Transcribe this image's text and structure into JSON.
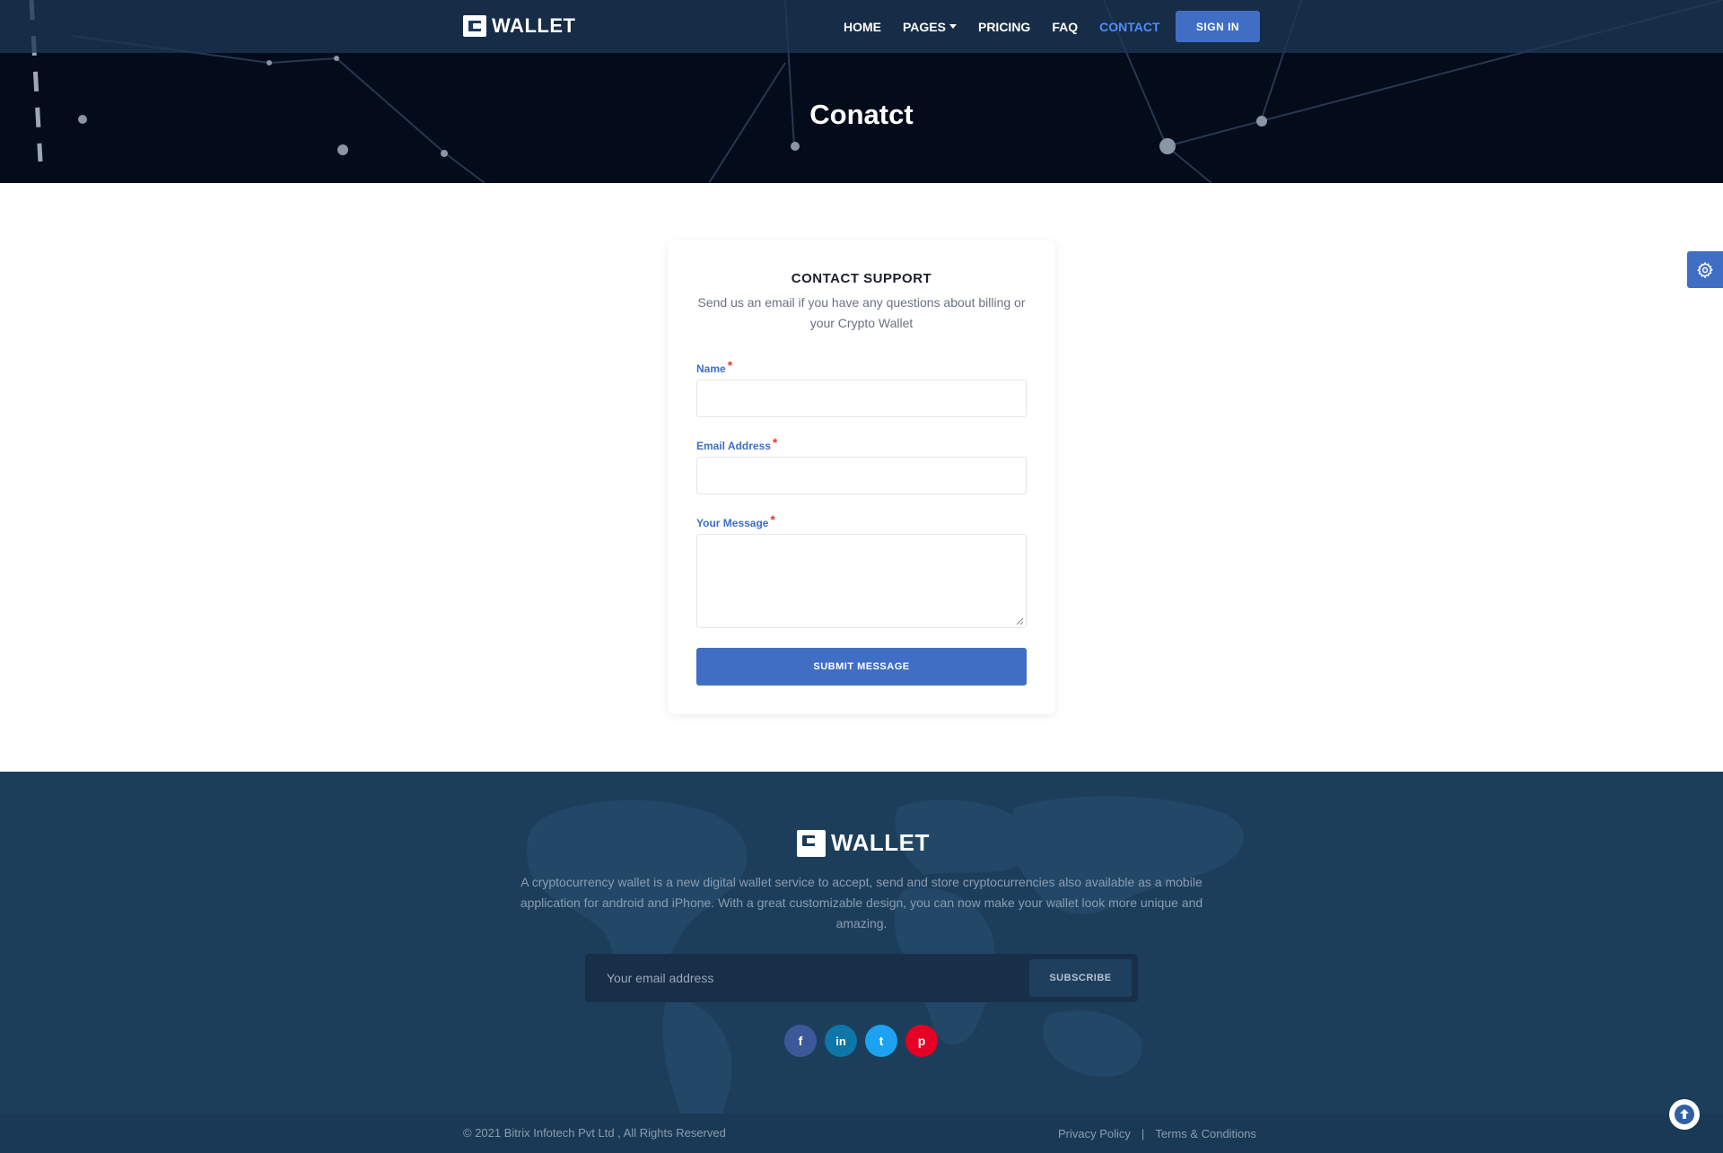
{
  "header": {
    "logo_text": "WALLET",
    "nav": [
      {
        "label": "HOME"
      },
      {
        "label": "PAGES"
      },
      {
        "label": "PRICING"
      },
      {
        "label": "FAQ"
      },
      {
        "label": "CONTACT",
        "active": true
      }
    ],
    "signin_label": "SIGN IN",
    "page_title": "Conatct"
  },
  "form": {
    "title": "CONTACT SUPPORT",
    "subtitle": "Send us an email if you have any questions about billing or your Crypto Wallet",
    "name_label": "Name",
    "email_label": "Email Address",
    "message_label": "Your Message",
    "required_mark": "*",
    "name_value": "",
    "email_value": "",
    "message_value": "",
    "submit_label": "SUBMIT MESSAGE"
  },
  "settings": {
    "icon": "gear-icon"
  },
  "footer": {
    "logo_text": "WALLET",
    "description": "A cryptocurrency wallet is a new digital wallet service to accept, send and store cryptocurrencies also available as a mobile application for android and iPhone. With a great customizable design, you can now make your wallet look more unique and amazing.",
    "subscribe_placeholder": "Your email address",
    "subscribe_label": "SUBSCRIBE",
    "socials": [
      {
        "name": "facebook-icon",
        "glyph": "f",
        "color": "#3b5998"
      },
      {
        "name": "linkedin-icon",
        "glyph": "in",
        "color": "#0e76a8"
      },
      {
        "name": "twitter-icon",
        "glyph": "t",
        "color": "#1da1f2"
      },
      {
        "name": "pinterest-icon",
        "glyph": "p",
        "color": "#e60023"
      }
    ],
    "copyright": "© 2021 Bitrix Infotech Pvt Ltd , All Rights Reserved",
    "privacy_label": "Privacy Policy",
    "separator": "|",
    "terms_label": "Terms & Conditions"
  },
  "colors": {
    "accent": "#3f6ec4",
    "nav_active": "#4f8cff",
    "hero_bg": "#040b1a",
    "footer_bg": "#1d3e5b",
    "required": "#e53935"
  }
}
